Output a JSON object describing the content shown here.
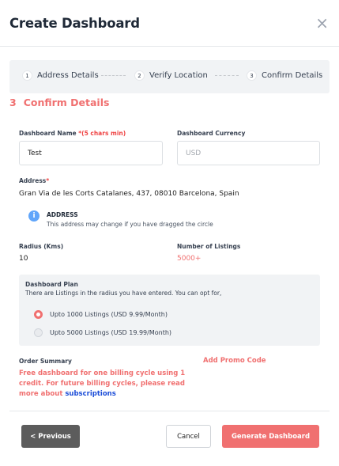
{
  "modal": {
    "title": "Create Dashboard",
    "close_icon": "×"
  },
  "stepper": {
    "steps": [
      {
        "num": "1",
        "label": "Address Details"
      },
      {
        "num": "2",
        "label": "Verify Location"
      },
      {
        "num": "3",
        "label": "Confirm Details"
      }
    ]
  },
  "section": {
    "num": "3",
    "title": "Confirm Details"
  },
  "form": {
    "name_label": "Dashboard Name",
    "name_required": "*(5 chars min)",
    "name_value": "Test",
    "currency_label": "Dashboard Currency",
    "currency_value": "USD",
    "address_label": "Address",
    "address_required": "*",
    "address_value": "Gran Via de les Corts Catalanes, 437, 08010 Barcelona, Spain",
    "info_icon": "i",
    "info_title": "ADDRESS",
    "info_text": "This address may change if you have dragged the circle",
    "radius_label": "Radius (Kms)",
    "radius_value": "10",
    "listings_label": "Number of Listings",
    "listings_value": "5000+"
  },
  "plan": {
    "title": "Dashboard Plan",
    "description": "There are Listings in the radius you have entered. You can opt for,",
    "options": [
      {
        "label": "Upto 1000 Listings (USD 9.99/Month)",
        "selected": true
      },
      {
        "label": "Upto 5000 Listings (USD 19.99/Month)",
        "selected": false
      }
    ]
  },
  "order": {
    "label": "Order Summary",
    "promo": "Add Promo Code",
    "free_text": "Free dashboard for one billing cycle using 1 credit. For future billing cycles, please read more about",
    "link": "subscriptions"
  },
  "footer": {
    "previous": "< Previous",
    "cancel": "Cancel",
    "generate": "Generate Dashboard"
  },
  "colors": {
    "accent": "#f07070",
    "link": "#1d4ed8",
    "info": "#60a5fa",
    "dark_button": "#5c5c5c"
  }
}
